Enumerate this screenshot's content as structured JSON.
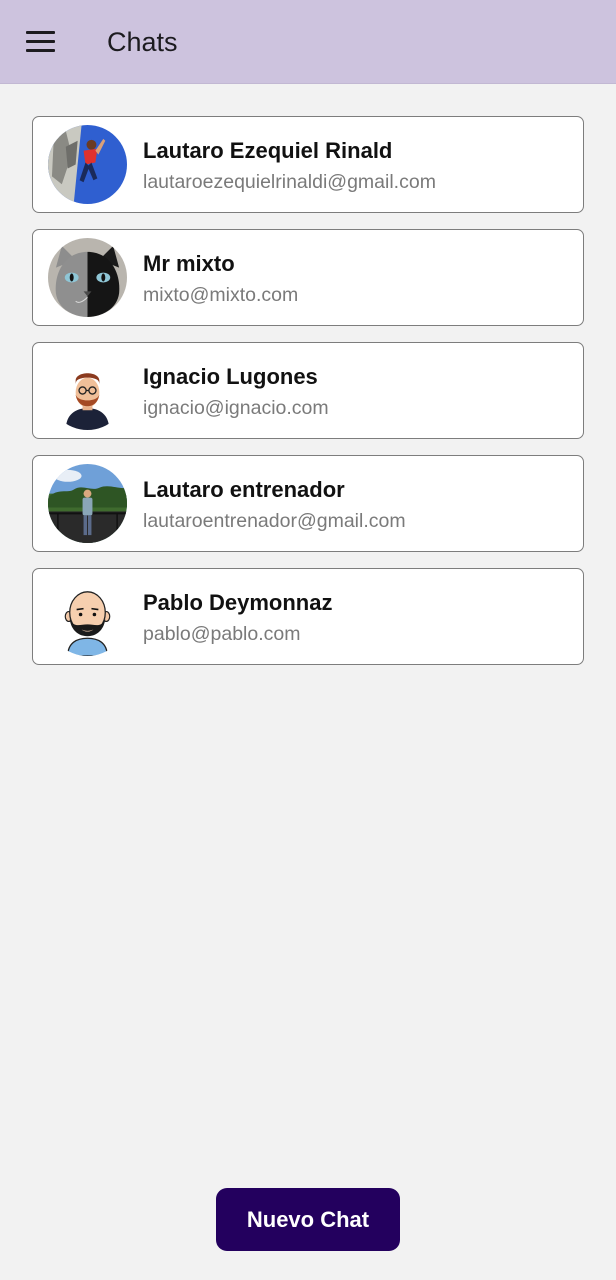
{
  "appbar": {
    "title": "Chats",
    "menu_icon": "hamburger-menu-icon"
  },
  "chats": [
    {
      "name": "Lautaro Ezequiel Rinald",
      "email": "lautaroezequielrinaldi@gmail.com",
      "avatar": "photo-climber-avatar"
    },
    {
      "name": "Mr mixto",
      "email": "mixto@mixto.com",
      "avatar": "photo-cat-avatar"
    },
    {
      "name": "Ignacio Lugones",
      "email": "ignacio@ignacio.com",
      "avatar": "cartoon-bearded-man-avatar"
    },
    {
      "name": "Lautaro entrenador",
      "email": "lautaroentrenador@gmail.com",
      "avatar": "photo-park-avatar"
    },
    {
      "name": "Pablo Deymonnaz",
      "email": "pablo@pablo.com",
      "avatar": "cartoon-bald-man-avatar"
    }
  ],
  "fab": {
    "label": "Nuevo Chat"
  },
  "colors": {
    "appbar": "#cdc3de",
    "background": "#f2f2f2",
    "button": "#23005e",
    "card_border": "#7d7d7d"
  }
}
